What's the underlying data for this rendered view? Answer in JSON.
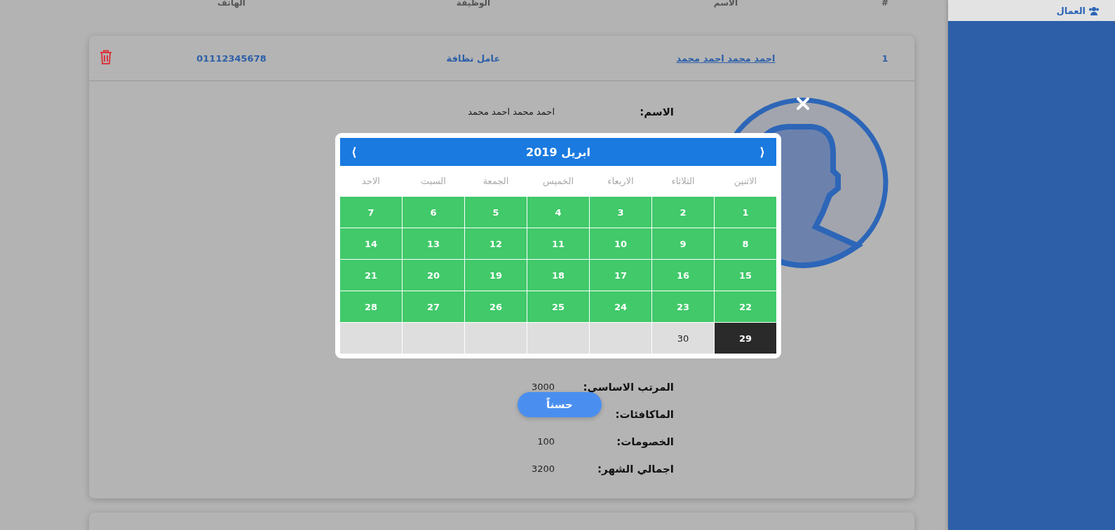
{
  "sidebar": {
    "items": [
      {
        "label": "العمال",
        "selected": true
      }
    ]
  },
  "table": {
    "columns": [
      "#",
      "الاسم",
      "الوظيفة",
      "الهاتف"
    ],
    "rows": [
      {
        "index": "1",
        "name": "احمد محمد احمد محمد",
        "job": "عامل نظافة",
        "phone": "01112345678",
        "expanded": true
      }
    ]
  },
  "details": [
    {
      "label": "الاسم:",
      "value": "احمد محمد احمد محمد"
    },
    {
      "label": "المرتب الاساسي:",
      "value": "3000"
    },
    {
      "label": "الماكافئات:"
    },
    {
      "label": "الخصومات:",
      "value": "100"
    },
    {
      "label": "اجمالي الشهر:",
      "value": "3200"
    }
  ],
  "calendar": {
    "title": "ابريل 2019",
    "prev": "⟨",
    "next": "⟩",
    "weekdays": [
      "الاثنين",
      "الثلاثاء",
      "الاربعاء",
      "الخميس",
      "الجمعة",
      "السبت",
      "الاحد"
    ],
    "days": [
      {
        "label": "1",
        "kind": "available"
      },
      {
        "label": "2",
        "kind": "available"
      },
      {
        "label": "3",
        "kind": "available"
      },
      {
        "label": "4",
        "kind": "available"
      },
      {
        "label": "5",
        "kind": "available"
      },
      {
        "label": "6",
        "kind": "available"
      },
      {
        "label": "7",
        "kind": "available"
      },
      {
        "label": "8",
        "kind": "available"
      },
      {
        "label": "9",
        "kind": "available"
      },
      {
        "label": "10",
        "kind": "available"
      },
      {
        "label": "11",
        "kind": "available"
      },
      {
        "label": "12",
        "kind": "available"
      },
      {
        "label": "13",
        "kind": "available"
      },
      {
        "label": "14",
        "kind": "available"
      },
      {
        "label": "15",
        "kind": "available"
      },
      {
        "label": "16",
        "kind": "available"
      },
      {
        "label": "17",
        "kind": "available"
      },
      {
        "label": "18",
        "kind": "available"
      },
      {
        "label": "19",
        "kind": "available"
      },
      {
        "label": "20",
        "kind": "available"
      },
      {
        "label": "21",
        "kind": "available"
      },
      {
        "label": "22",
        "kind": "available"
      },
      {
        "label": "23",
        "kind": "available"
      },
      {
        "label": "24",
        "kind": "available"
      },
      {
        "label": "25",
        "kind": "available"
      },
      {
        "label": "26",
        "kind": "available"
      },
      {
        "label": "27",
        "kind": "available"
      },
      {
        "label": "28",
        "kind": "available"
      },
      {
        "label": "29",
        "kind": "selected"
      },
      {
        "label": "30",
        "kind": "unavailable"
      }
    ]
  },
  "ok_button": "حسناً"
}
